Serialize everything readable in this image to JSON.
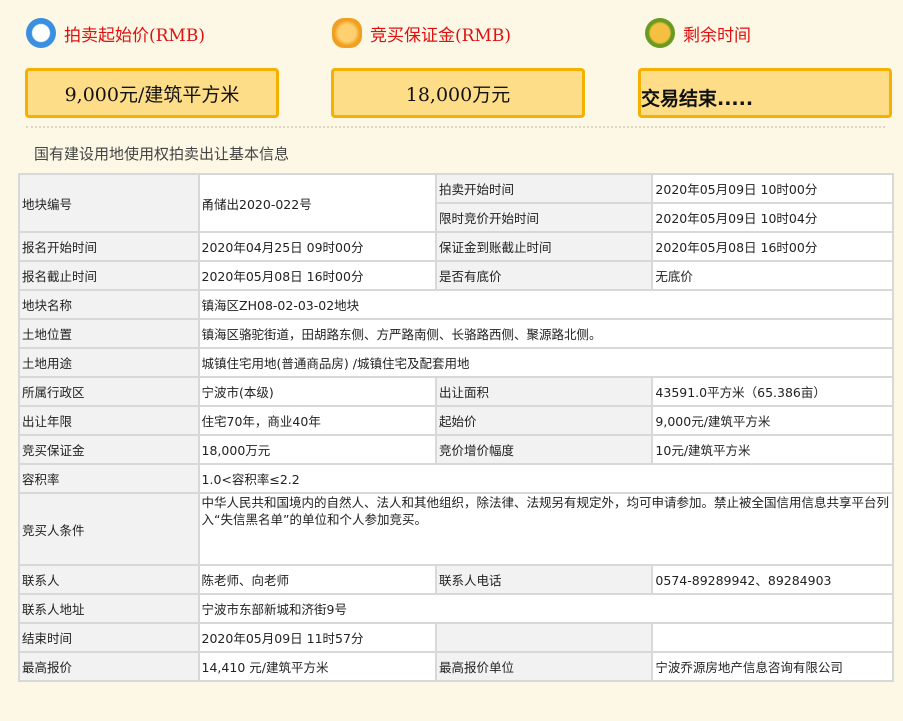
{
  "header": [
    {
      "label": "拍卖起始价(RMB)",
      "value": "9,000元/建筑平方米",
      "icon": "clock-money-icon"
    },
    {
      "label": "竞买保证金(RMB)",
      "value": "18,000万元",
      "icon": "money-bag-icon"
    },
    {
      "label": "剩余时间",
      "value": "交易结束.....",
      "icon": "alarm-clock-icon"
    }
  ],
  "section_title": "国有建设用地使用权拍卖出让基本信息",
  "t": {
    "plot_no_l": "地块编号",
    "plot_no": "甬储出2020-022号",
    "auction_start_l": "拍卖开始时间",
    "auction_start": "2020年05月09日 10时00分",
    "timed_start_l": "限时竞价开始时间",
    "timed_start": "2020年05月09日 10时04分",
    "reg_start_l": "报名开始时间",
    "reg_start": "2020年04月25日 09时00分",
    "deposit_deadline_l": "保证金到账截止时间",
    "deposit_deadline": "2020年05月08日 16时00分",
    "reg_end_l": "报名截止时间",
    "reg_end": "2020年05月08日 16时00分",
    "reserve_l": "是否有底价",
    "reserve": "无底价",
    "name_l": "地块名称",
    "name": "镇海区ZH08-02-03-02地块",
    "location_l": "土地位置",
    "location": "镇海区骆驼街道，田胡路东侧、方严路南侧、长骆路西侧、聚源路北侧。",
    "use_l": "土地用途",
    "use": "城镇住宅用地(普通商品房) /城镇住宅及配套用地",
    "district_l": "所属行政区",
    "district": "宁波市(本级)",
    "area_l": "出让面积",
    "area": "43591.0平方米（65.386亩）",
    "term_l": "出让年限",
    "term": "住宅70年，商业40年",
    "start_price_l": "起始价",
    "start_price": "9,000元/建筑平方米",
    "deposit_l": "竞买保证金",
    "deposit": "18,000万元",
    "increment_l": "竞价增价幅度",
    "increment": "10元/建筑平方米",
    "far_l": "容积率",
    "far": "1.0<容积率≤2.2",
    "cond_l": "竞买人条件",
    "cond": "中华人民共和国境内的自然人、法人和其他组织，除法律、法规另有规定外，均可申请参加。禁止被全国信用信息共享平台列入“失信黑名单”的单位和个人参加竞买。",
    "contact_l": "联系人",
    "contact": "陈老师、向老师",
    "phone_l": "联系人电话",
    "phone": "0574-89289942、89284903",
    "addr_l": "联系人地址",
    "addr": "宁波市东部新城和济街9号",
    "end_l": "结束时间",
    "end": "2020年05月09日 11时57分",
    "top_l": "最高报价",
    "top": "14,410 元/建筑平方米",
    "top_unit_l": "最高报价单位",
    "top_unit": "宁波乔源房地产信息咨询有限公司"
  }
}
